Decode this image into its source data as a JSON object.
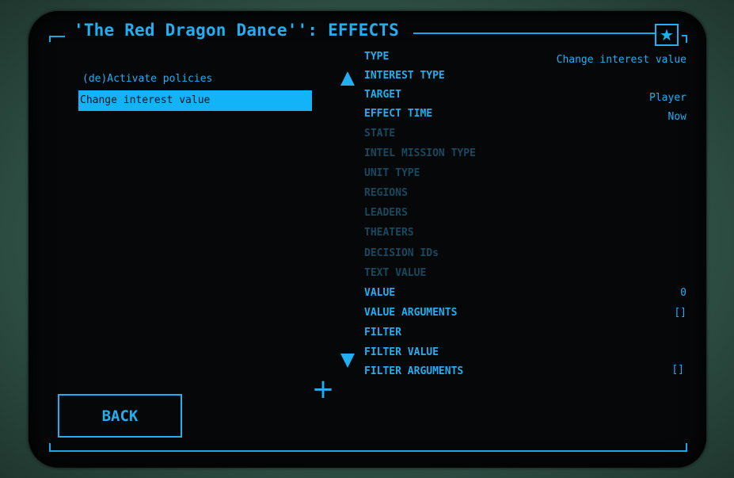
{
  "header": {
    "title": "'The Red Dragon Dance'': EFFECTS",
    "star_icon": "star-icon",
    "accent_color": "#22aef0"
  },
  "policies": [
    {
      "label": "(de)Activate policies",
      "selected": false
    },
    {
      "label": "Change interest value",
      "selected": true
    }
  ],
  "properties": [
    {
      "label": "TYPE",
      "value": "Change interest value",
      "enabled": true
    },
    {
      "label": "INTEREST TYPE",
      "value": "",
      "enabled": true
    },
    {
      "label": "TARGET",
      "value": "Player",
      "enabled": true
    },
    {
      "label": "EFFECT TIME",
      "value": "Now",
      "enabled": true
    },
    {
      "label": "STATE",
      "value": "",
      "enabled": false
    },
    {
      "label": "INTEL MISSION TYPE",
      "value": "",
      "enabled": false
    },
    {
      "label": "UNIT TYPE",
      "value": "",
      "enabled": false
    },
    {
      "label": "REGIONS",
      "value": "",
      "enabled": false
    },
    {
      "label": "LEADERS",
      "value": "",
      "enabled": false
    },
    {
      "label": "THEATERS",
      "value": "",
      "enabled": false
    },
    {
      "label": "DECISION IDs",
      "value": "",
      "enabled": false
    },
    {
      "label": "TEXT VALUE",
      "value": "",
      "enabled": false
    },
    {
      "label": "VALUE",
      "value": "0",
      "enabled": true
    },
    {
      "label": "VALUE ARGUMENTS",
      "value": "[]",
      "enabled": true
    },
    {
      "label": "FILTER",
      "value": "",
      "enabled": true
    },
    {
      "label": "FILTER VALUE",
      "value": "",
      "enabled": true
    },
    {
      "label": "FILTER ARGUMENTS",
      "value": "[]",
      "enabled": true
    }
  ],
  "controls": {
    "scroll_up_icon": "triangle-up-icon",
    "scroll_down_icon": "triangle-down-icon",
    "add_icon": "plus-icon",
    "back_label": "BACK"
  }
}
